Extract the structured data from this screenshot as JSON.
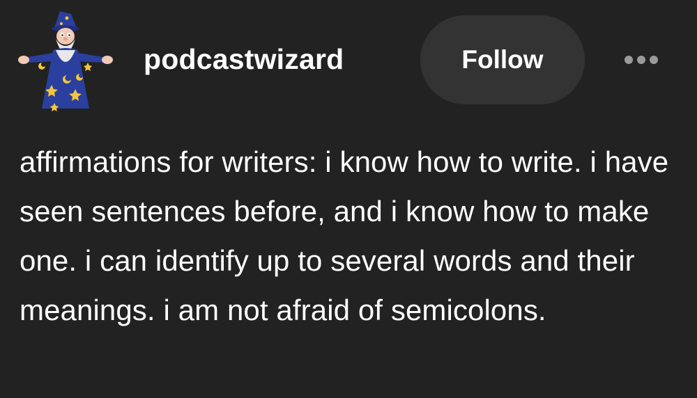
{
  "post": {
    "author": {
      "username": "podcastwizard",
      "avatar_icon": "wizard-avatar-icon"
    },
    "follow_label": "Follow",
    "more_icon": "ellipsis-icon",
    "body": "affirmations for writers: i know how to write. i have seen sentences before, and i know how to make one. i can identify up to several words and their meanings. i am not afraid of semicolons."
  },
  "colors": {
    "background": "#222222",
    "follow_button": "#333333",
    "text": "#ffffff",
    "more_dots": "#9a9a9a",
    "wizard_robe": "#2a3f9e",
    "wizard_stars": "#f2c53d"
  }
}
